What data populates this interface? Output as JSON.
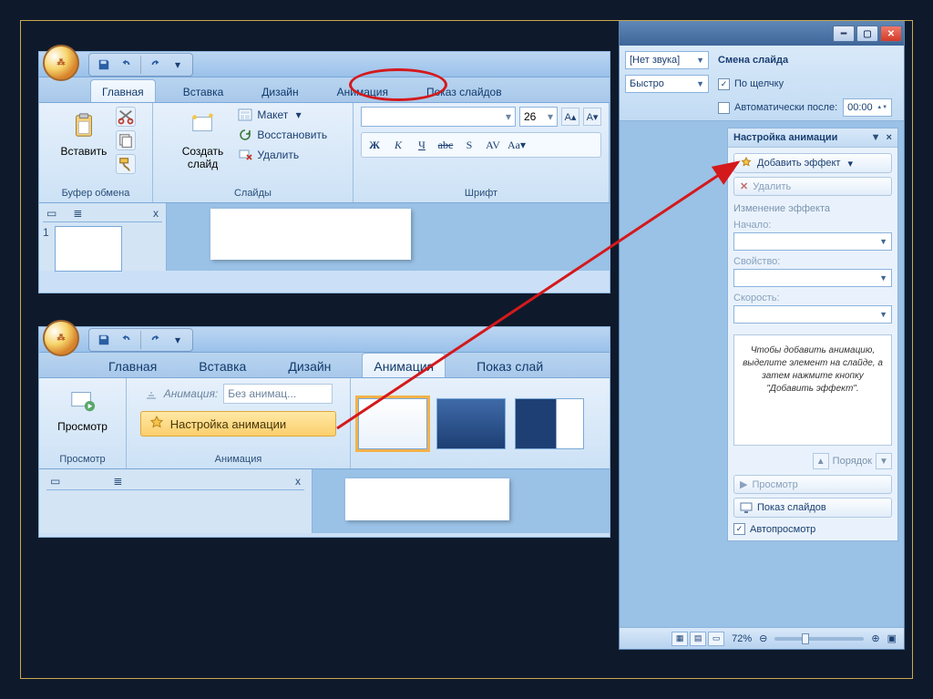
{
  "panel1": {
    "tabs": [
      "Главная",
      "Вставка",
      "Дизайн",
      "Анимация",
      "Показ слайдов"
    ],
    "active_tab_index": 0,
    "clipboard": {
      "paste": "Вставить",
      "group": "Буфер обмена"
    },
    "slides": {
      "new_slide": "Создать\nслайд",
      "layout": "Макет",
      "reset": "Восстановить",
      "delete": "Удалить",
      "group": "Слайды"
    },
    "font": {
      "group": "Шрифт",
      "size": "26",
      "bold": "Ж",
      "italic": "К",
      "underline": "Ч",
      "strike": "abc",
      "shadow": "S",
      "spacing": "AV",
      "case": "Aa"
    },
    "slide_number": "1"
  },
  "panel2": {
    "tabs": [
      "Главная",
      "Вставка",
      "Дизайн",
      "Анимация",
      "Показ слай"
    ],
    "active_tab_index": 3,
    "preview": {
      "btn": "Просмотр",
      "group": "Просмотр"
    },
    "anim": {
      "label": "Анимация:",
      "combo": "Без анимац...",
      "btn": "Настройка анимации",
      "group": "Анимация"
    }
  },
  "panel3": {
    "sound_combo": "[Нет звука]",
    "speed_combo": "Быстро",
    "advance_title": "Смена слайда",
    "on_click": "По щелчку",
    "auto_after": "Автоматически после:",
    "auto_after_value": "00:00",
    "pane_title": "Настройка анимации",
    "add_effect": "Добавить эффект",
    "remove": "Удалить",
    "change_effect": "Изменение эффекта",
    "start_label": "Начало:",
    "property_label": "Свойство:",
    "speed_label": "Скорость:",
    "hint": "Чтобы добавить анимацию, выделите элемент на слайде, а затем нажмите кнопку \"Добавить эффект\".",
    "order": "Порядок",
    "preview_btn": "Просмотр",
    "slideshow_btn": "Показ слайдов",
    "autoplay": "Автопросмотр",
    "zoom": "72%"
  }
}
